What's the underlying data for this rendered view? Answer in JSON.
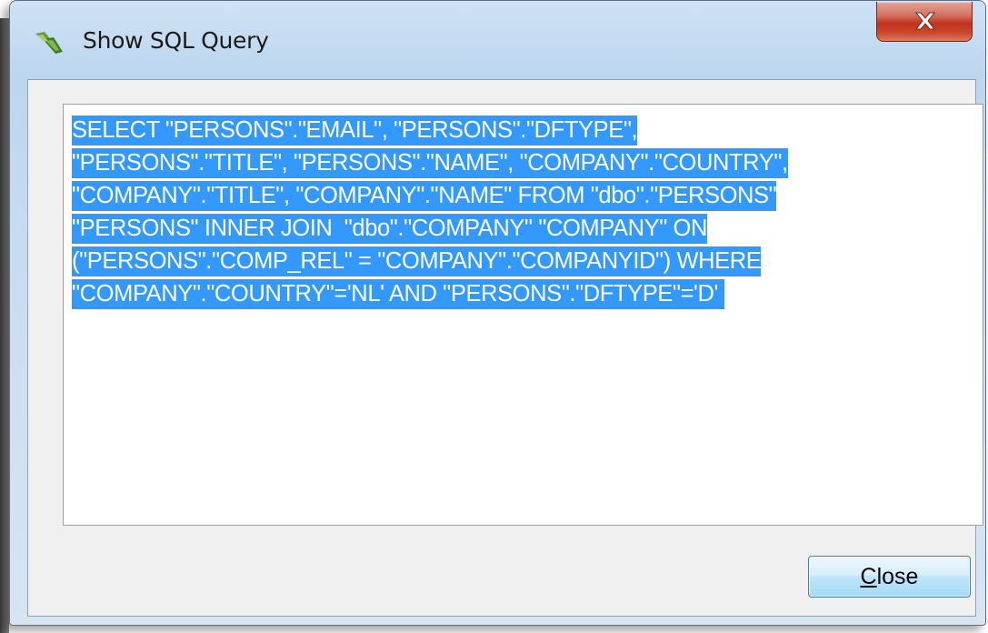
{
  "window": {
    "title": "Show SQL Query",
    "icon": "sql-query-icon",
    "close_glyph": "close-icon"
  },
  "sql": {
    "lines": [
      "SELECT \"PERSONS\".\"EMAIL\", \"PERSONS\".\"DFTYPE\",",
      "\"PERSONS\".\"TITLE\", \"PERSONS\".\"NAME\", \"COMPANY\".\"COUNTRY\",",
      "\"COMPANY\".\"TITLE\", \"COMPANY\".\"NAME\" FROM \"dbo\".\"PERSONS\"",
      "\"PERSONS\" INNER JOIN  \"dbo\".\"COMPANY\" \"COMPANY\" ON",
      "(\"PERSONS\".\"COMP_REL\" = \"COMPANY\".\"COMPANYID\") WHERE",
      "\"COMPANY\".\"COUNTRY\"='NL' AND \"PERSONS\".\"DFTYPE\"='D' "
    ],
    "selected": true
  },
  "buttons": {
    "close_label_underlined": "C",
    "close_label_rest": "lose"
  },
  "colors": {
    "selection": "#3399ff",
    "close_button_red": "#c2321c"
  }
}
